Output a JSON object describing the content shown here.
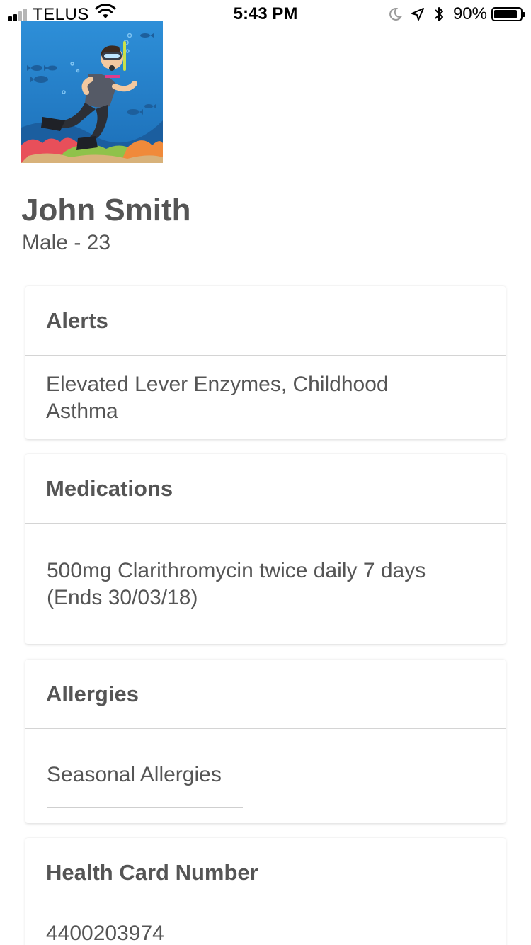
{
  "status_bar": {
    "carrier": "TELUS",
    "time": "5:43 PM",
    "battery_percent": "90%",
    "battery_level": 0.9,
    "signal_bars_filled": 2,
    "signal_bars_total": 4
  },
  "profile": {
    "name": "John Smith",
    "gender_age": "Male - 23",
    "avatar_icon": "scuba-diver-avatar"
  },
  "cards": {
    "alerts": {
      "title": "Alerts",
      "text": "Elevated Lever Enzymes, Childhood Asthma"
    },
    "medications": {
      "title": "Medications",
      "items": [
        "500mg Clarithromycin twice daily 7 days (Ends 30/03/18)"
      ]
    },
    "allergies": {
      "title": "Allergies",
      "items": [
        "Seasonal Allergies"
      ]
    },
    "health_card": {
      "title": "Health Card Number",
      "value": "4400203974"
    }
  },
  "colors": {
    "text": "#555555",
    "divider": "#d4d4d4",
    "background": "#ffffff"
  }
}
